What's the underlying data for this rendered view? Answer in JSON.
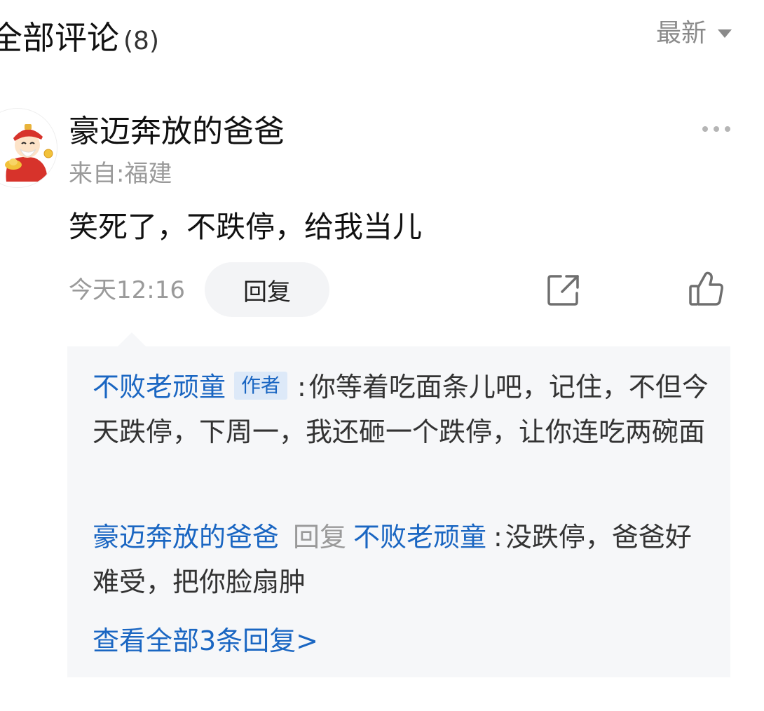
{
  "header": {
    "title": "全部评论",
    "count": "(8)",
    "sort_label": "最新",
    "sort_icon": "caret-down-icon"
  },
  "comment": {
    "username": "豪迈奔放的爸爸",
    "location": "来自:福建",
    "text": "笑死了，不跌停，给我当儿",
    "time": "今天12:16",
    "reply_button": "回复",
    "more_icon": "more-horizontal-icon",
    "share_icon": "share-icon",
    "like_icon": "thumbs-up-icon"
  },
  "replies": [
    {
      "name": "不败老顽童",
      "tag": "作者",
      "sep": ":",
      "text": "你等着吃面条儿吧，记住，不但今天跌停，下周一，我还砸一个跌停，让你连吃两碗面"
    },
    {
      "name": "豪迈奔放的爸爸",
      "reply_word": "回复",
      "target": "不败老顽童",
      "sep": ":",
      "text": "没跌停，爸爸好难受，把你脸扇肿"
    }
  ],
  "view_all": "查看全部3条回复>",
  "colors": {
    "link": "#1a66c2",
    "muted": "#9a9a9a",
    "reply_bg": "#f6f7f9",
    "tag_bg": "#dde9f8"
  }
}
